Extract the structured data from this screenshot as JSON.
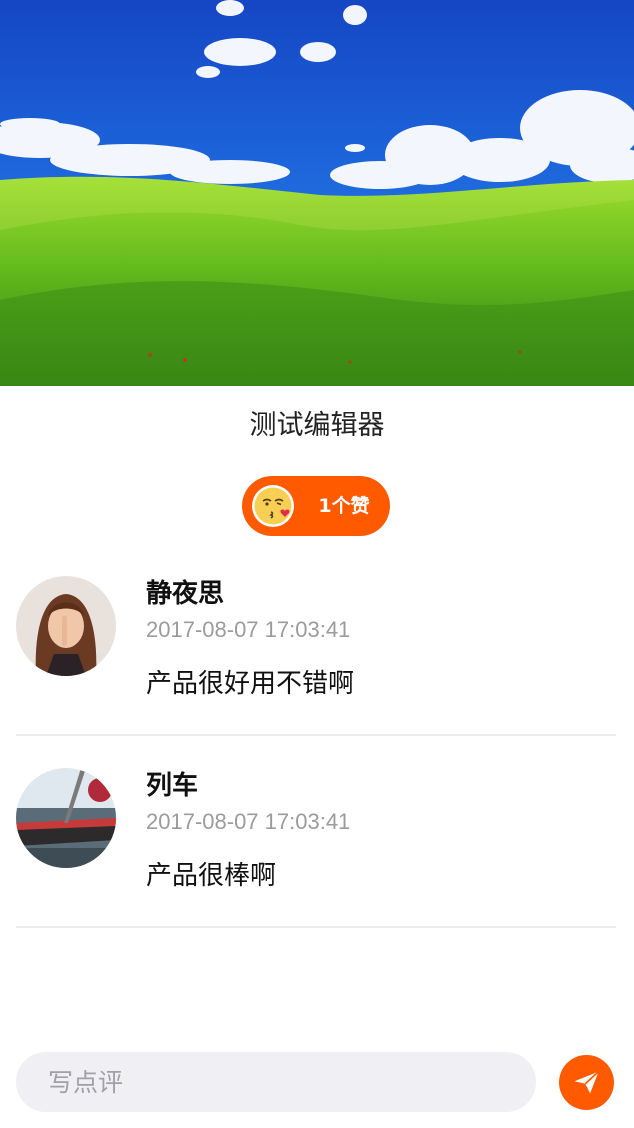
{
  "article": {
    "title": "测试编辑器"
  },
  "likes": {
    "label": "1个赞",
    "emoji_icon": "kiss-emoji-icon"
  },
  "comments": [
    {
      "name": "静夜思",
      "time": "2017-08-07 17:03:41",
      "text": "产品很好用不错啊"
    },
    {
      "name": "列车",
      "time": "2017-08-07 17:03:41",
      "text": "产品很棒啊"
    }
  ],
  "composer": {
    "placeholder": "写点评",
    "send_icon": "paper-plane-icon"
  },
  "colors": {
    "accent": "#ff5a00",
    "muted_text": "#9b9b9b",
    "input_bg": "#efeff4"
  }
}
